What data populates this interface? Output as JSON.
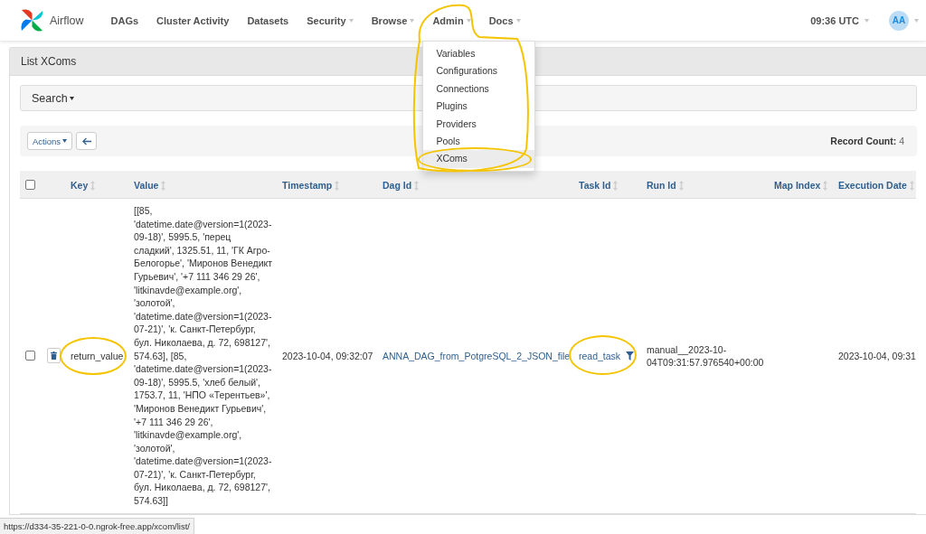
{
  "navbar": {
    "brand": "Airflow",
    "items": [
      {
        "label": "DAGs",
        "kind": "link",
        "expanded": false,
        "circled": false
      },
      {
        "label": "Cluster Activity",
        "kind": "link",
        "expanded": false,
        "circled": false
      },
      {
        "label": "Datasets",
        "kind": "link",
        "expanded": false,
        "circled": false
      },
      {
        "label": "Security",
        "kind": "menu",
        "expanded": false,
        "circled": false
      },
      {
        "label": "Browse",
        "kind": "menu",
        "expanded": false,
        "circled": false
      },
      {
        "label": "Admin",
        "kind": "menu",
        "expanded": true,
        "circled": true,
        "menu": [
          {
            "label": "Variables",
            "selected": false,
            "circled": false
          },
          {
            "label": "Configurations",
            "selected": false,
            "circled": false
          },
          {
            "label": "Connections",
            "selected": false,
            "circled": false
          },
          {
            "label": "Plugins",
            "selected": false,
            "circled": false
          },
          {
            "label": "Providers",
            "selected": false,
            "circled": false
          },
          {
            "label": "Pools",
            "selected": false,
            "circled": false
          },
          {
            "label": "XComs",
            "selected": true,
            "circled": true
          }
        ]
      },
      {
        "label": "Docs",
        "kind": "menu",
        "expanded": false,
        "circled": false
      }
    ],
    "clock": "09:36 UTC",
    "avatar": "AA"
  },
  "panel": {
    "title": "List XComs",
    "search": "Search",
    "actions": "Actions",
    "record_count": "**Record Count:** 4"
  },
  "table": {
    "select_all": {
      "checked": false
    },
    "columns": [
      "Key",
      "Value",
      "Timestamp",
      "Dag Id",
      "Task Id",
      "Run Id",
      "Map Index",
      "Execution Date"
    ],
    "rows": [
      {
        "checked": false,
        "key": {
          "text": "return_value",
          "circled": true
        },
        "value": "[[85, 'datetime.date@version=1(2023-09-18)', 5995.5, 'перец сладкий', 1325.51, 11, 'ГК Агро-Белогорье', 'Миронов Венедикт Гурьевич', '+7 111 346 29 26', 'litkinavde@example.org', 'золотой', 'datetime.date@version=1(2023-07-21)', 'к. Санкт-Петербург, бул. Николаева, д. 72, 698127', 574.63], [85, 'datetime.date@version=1(2023-09-18)', 5995.5, 'хлеб белый', 1753.7, 11, 'НПО «Терентьев»', 'Миронов Венедикт Гурьевич', '+7 111 346 29 26', 'litkinavde@example.org', 'золотой', 'datetime.date@version=1(2023-07-21)', 'к. Санкт-Петербург, бул. Николаева, д. 72, 698127', 574.63]]",
        "timestamp": "2023-10-04, 09:32:07",
        "dag_id": "ANNA_DAG_from_PotgreSQL_2_JSON_file",
        "task_id": {
          "text": "read_task",
          "circled": true
        },
        "run_id": "manual__2023-10-04T09:31:57.976540+00:00",
        "execution_date": "2023-10-04, 09:31"
      }
    ]
  },
  "status_url": "https://d334-35-221-0-0.ngrok-free.app/xcom/list/"
}
